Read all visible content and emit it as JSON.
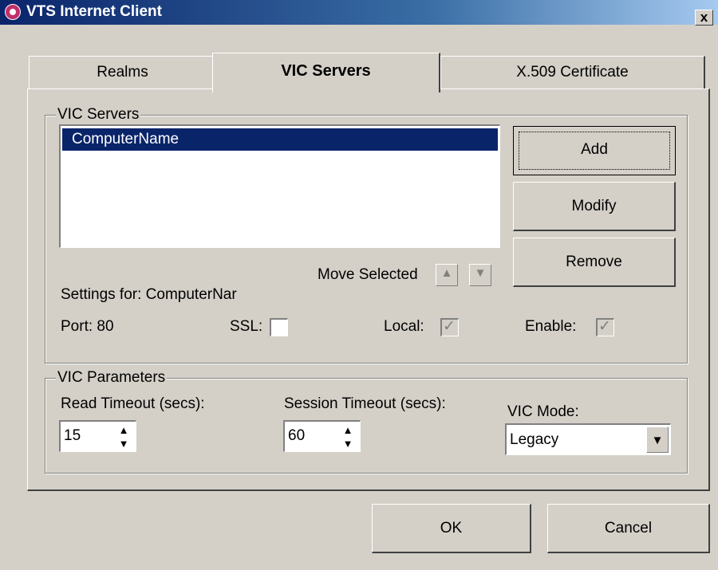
{
  "window": {
    "title": "VTS Internet Client",
    "close_symbol": "x"
  },
  "tabs": [
    {
      "label": "Realms",
      "active": false
    },
    {
      "label": "VIC Servers",
      "active": true
    },
    {
      "label": "X.509 Certificate",
      "active": false
    }
  ],
  "servers_group": {
    "legend": "VIC Servers",
    "list_items": [
      "ComputerName"
    ],
    "selected_index": 0,
    "buttons": {
      "add": "Add",
      "modify": "Modify",
      "remove": "Remove"
    },
    "move_selected_label": "Move Selected",
    "move_up_symbol": "▲",
    "move_down_symbol": "▼",
    "settings_label": "Settings for: ComputerNar",
    "port_label": "Port: 80",
    "ssl_label": "SSL:",
    "ssl_checked": false,
    "local_label": "Local:",
    "local_checked": true,
    "enable_label": "Enable:",
    "enable_checked": true,
    "check_symbol": "✓"
  },
  "params_group": {
    "legend": "VIC Parameters",
    "read_timeout_label": "Read Timeout (secs):",
    "read_timeout_value": "15",
    "session_timeout_label": "Session Timeout (secs):",
    "session_timeout_value": "60",
    "mode_label": "VIC Mode:",
    "mode_value": "Legacy",
    "spin_up_symbol": "▲",
    "spin_down_symbol": "▼",
    "combo_arrow_symbol": "▼"
  },
  "footer": {
    "ok": "OK",
    "cancel": "Cancel"
  }
}
